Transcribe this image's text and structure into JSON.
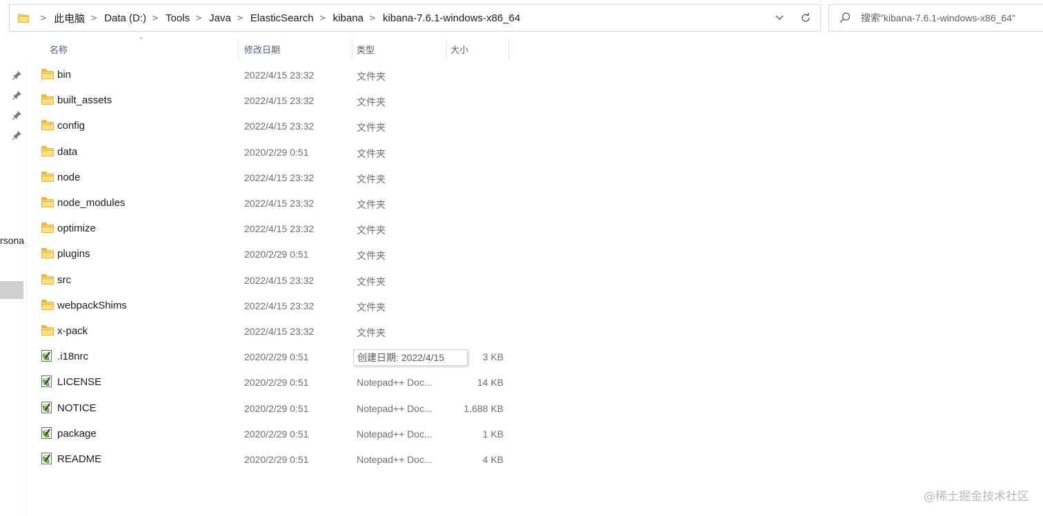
{
  "address_bar": {
    "breadcrumbs": [
      "此电脑",
      "Data (D:)",
      "Tools",
      "Java",
      "ElasticSearch",
      "kibana",
      "kibana-7.6.1-windows-x86_64"
    ],
    "separator": ">",
    "dropdown_icon": "chevron-down-icon",
    "refresh_icon": "refresh-icon"
  },
  "search": {
    "placeholder": "搜索\"kibana-7.6.1-windows-x86_64\""
  },
  "columns": {
    "name": "名称",
    "modified": "修改日期",
    "type": "类型",
    "size": "大小"
  },
  "left_nav": {
    "partial_label": "rsona"
  },
  "files": [
    {
      "name": "bin",
      "date": "2022/4/15 23:32",
      "type": "文件夹",
      "size": "",
      "icon": "folder-icon"
    },
    {
      "name": "built_assets",
      "date": "2022/4/15 23:32",
      "type": "文件夹",
      "size": "",
      "icon": "folder-icon"
    },
    {
      "name": "config",
      "date": "2022/4/15 23:32",
      "type": "文件夹",
      "size": "",
      "icon": "folder-icon"
    },
    {
      "name": "data",
      "date": "2020/2/29 0:51",
      "type": "文件夹",
      "size": "",
      "icon": "folder-icon"
    },
    {
      "name": "node",
      "date": "2022/4/15 23:32",
      "type": "文件夹",
      "size": "",
      "icon": "folder-icon"
    },
    {
      "name": "node_modules",
      "date": "2022/4/15 23:32",
      "type": "文件夹",
      "size": "",
      "icon": "folder-icon"
    },
    {
      "name": "optimize",
      "date": "2022/4/15 23:32",
      "type": "文件夹",
      "size": "",
      "icon": "folder-icon"
    },
    {
      "name": "plugins",
      "date": "2020/2/29 0:51",
      "type": "文件夹",
      "size": "",
      "icon": "folder-icon"
    },
    {
      "name": "src",
      "date": "2022/4/15 23:32",
      "type": "文件夹",
      "size": "",
      "icon": "folder-icon"
    },
    {
      "name": "webpackShims",
      "date": "2022/4/15 23:32",
      "type": "文件夹",
      "size": "",
      "icon": "folder-icon"
    },
    {
      "name": "x-pack",
      "date": "2022/4/15 23:32",
      "type": "文件夹",
      "size": "",
      "icon": "folder-icon"
    },
    {
      "name": ".i18nrc",
      "date": "2020/2/29 0:51",
      "type": "",
      "size": "3 KB",
      "icon": "notepadpp-document-icon"
    },
    {
      "name": "LICENSE",
      "date": "2020/2/29 0:51",
      "type": "Notepad++ Doc...",
      "size": "14 KB",
      "icon": "notepadpp-document-icon"
    },
    {
      "name": "NOTICE",
      "date": "2020/2/29 0:51",
      "type": "Notepad++ Doc...",
      "size": "1,688 KB",
      "icon": "notepadpp-document-icon"
    },
    {
      "name": "package",
      "date": "2020/2/29 0:51",
      "type": "Notepad++ Doc...",
      "size": "1 KB",
      "icon": "notepadpp-document-icon"
    },
    {
      "name": "README",
      "date": "2020/2/29 0:51",
      "type": "Notepad++ Doc...",
      "size": "4 KB",
      "icon": "notepadpp-document-icon"
    }
  ],
  "tooltip": {
    "text": "创建日期: 2022/4/15"
  },
  "watermark": "@稀土掘金技术社区"
}
